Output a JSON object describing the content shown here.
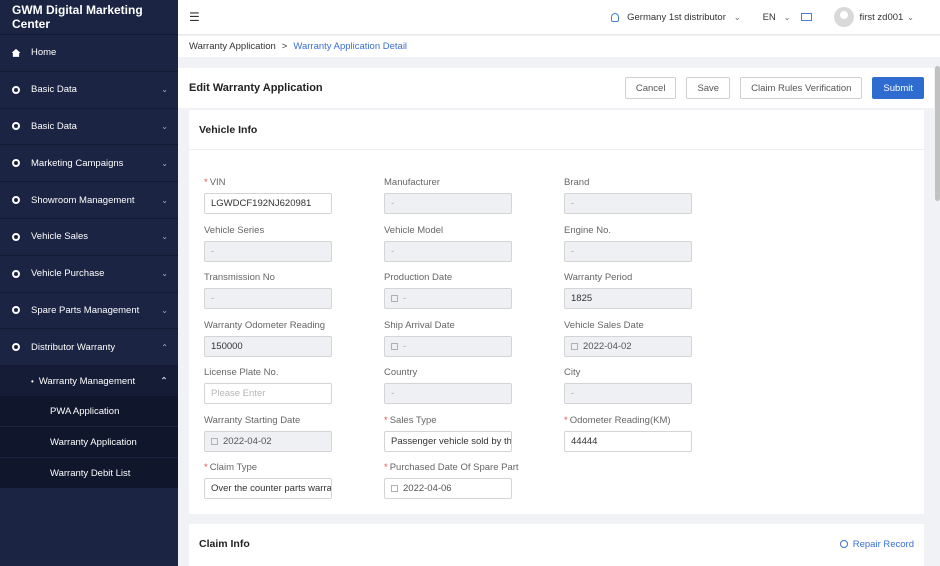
{
  "sidebar": {
    "brand": "GWM Digital Marketing Center",
    "items": [
      {
        "label": "Home",
        "icon": "home-icon"
      },
      {
        "label": "Basic Data",
        "icon": "circle-icon"
      },
      {
        "label": "Basic Data",
        "icon": "circle-icon"
      },
      {
        "label": "Marketing Campaigns",
        "icon": "circle-icon"
      },
      {
        "label": "Showroom Management",
        "icon": "circle-icon"
      },
      {
        "label": "Vehicle Sales",
        "icon": "circle-icon"
      },
      {
        "label": "Vehicle Purchase",
        "icon": "circle-icon"
      },
      {
        "label": "Spare Parts Management",
        "icon": "circle-icon"
      },
      {
        "label": "Distributor Warranty",
        "icon": "circle-icon"
      }
    ],
    "sub_menu": {
      "label": "Warranty Management"
    },
    "leaves": [
      "PWA Application",
      "Warranty Application",
      "Warranty Debit List"
    ]
  },
  "topbar": {
    "distributor": "Germany 1st distributor",
    "language": "EN",
    "user": "first zd001"
  },
  "breadcrumb": {
    "parent": "Warranty Application",
    "separator": ">",
    "current": "Warranty Application Detail"
  },
  "page": {
    "title": "Edit Warranty Application",
    "buttons": {
      "cancel": "Cancel",
      "save": "Save",
      "verify": "Claim Rules Verification",
      "submit": "Submit"
    }
  },
  "vehicle_info": {
    "title": "Vehicle Info",
    "fields": {
      "vin": {
        "label": "VIN",
        "value": "LGWDCF192NJ620981"
      },
      "manufacturer": {
        "label": "Manufacturer",
        "value": "-"
      },
      "brand": {
        "label": "Brand",
        "value": "-"
      },
      "vehicle_series": {
        "label": "Vehicle Series",
        "value": "-"
      },
      "vehicle_model": {
        "label": "Vehicle Model",
        "value": "-"
      },
      "engine_no": {
        "label": "Engine No.",
        "value": "-"
      },
      "transmission_no": {
        "label": "Transmission No",
        "value": "-"
      },
      "production_date": {
        "label": "Production Date",
        "value": "-"
      },
      "warranty_period": {
        "label": "Warranty Period",
        "value": "1825"
      },
      "warranty_odometer": {
        "label": "Warranty Odometer Reading",
        "value": "150000"
      },
      "ship_arrival_date": {
        "label": "Ship Arrival Date",
        "value": "-"
      },
      "vehicle_sales_date": {
        "label": "Vehicle Sales Date",
        "value": "2022-04-02"
      },
      "license_plate": {
        "label": "License Plate No.",
        "placeholder": "Please Enter"
      },
      "country": {
        "label": "Country",
        "value": "-"
      },
      "city": {
        "label": "City",
        "value": "-"
      },
      "warranty_start": {
        "label": "Warranty Starting Date",
        "value": "2022-04-02"
      },
      "sales_type": {
        "label": "Sales Type",
        "value": "Passenger vehicle sold by the"
      },
      "odometer_reading": {
        "label": "Odometer Reading(KM)",
        "value": "44444"
      },
      "claim_type": {
        "label": "Claim Type",
        "value": "Over the counter parts warranty"
      },
      "purchased_date": {
        "label": "Purchased Date Of Spare Part",
        "value": "2022-04-06"
      }
    }
  },
  "claim_info": {
    "title": "Claim Info",
    "repair_record": "Repair Record"
  }
}
